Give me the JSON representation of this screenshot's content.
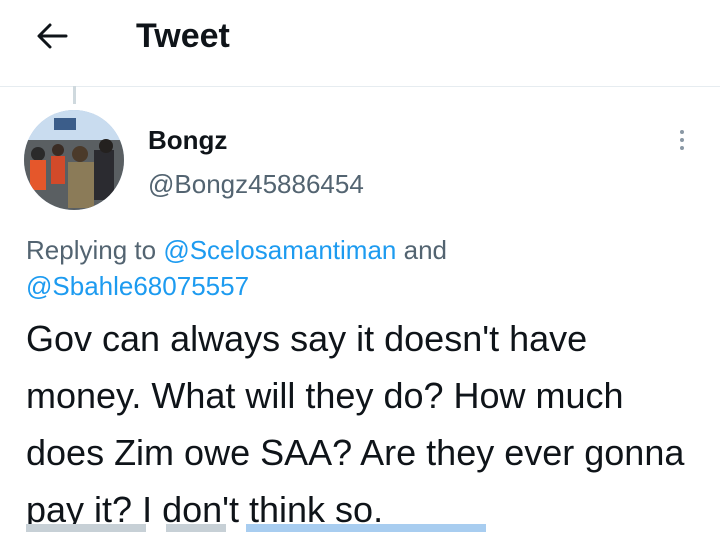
{
  "header": {
    "back_icon": "arrow-left-icon",
    "title": "Tweet"
  },
  "tweet": {
    "author": {
      "name": "Bongz",
      "handle": "@Bongz45886454",
      "avatar_icon": "profile-photo"
    },
    "more_icon": "more-vertical-icon",
    "replying_to_prefix": "Replying to",
    "mentions": [
      "@Scelosamantiman",
      "@Sbahle68075557"
    ],
    "mention_joiner": "and",
    "text": "Gov can always say it doesn't have money.  What will they do? How much does Zim owe SAA? Are they ever gonna pay it? I don't think so."
  },
  "colors": {
    "text": "#0f1419",
    "secondary": "#536471",
    "link": "#1d9bf0",
    "divider": "#e6ecf0"
  }
}
